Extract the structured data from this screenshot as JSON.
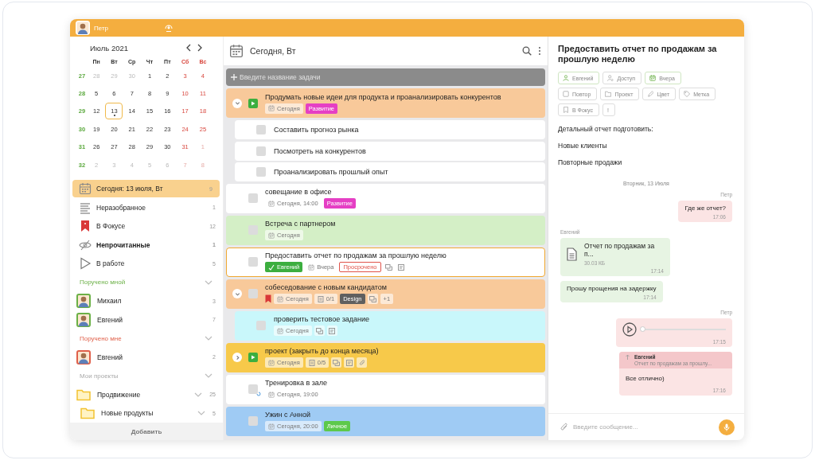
{
  "header": {
    "user": "Петр"
  },
  "calendar": {
    "month": "Июль 2021",
    "weekdays": [
      {
        "label": "Пн",
        "weekend": false
      },
      {
        "label": "Вт",
        "weekend": false
      },
      {
        "label": "Ср",
        "weekend": false
      },
      {
        "label": "Чт",
        "weekend": false
      },
      {
        "label": "Пт",
        "weekend": false
      },
      {
        "label": "Сб",
        "weekend": true
      },
      {
        "label": "Вс",
        "weekend": true
      }
    ],
    "weeks": [
      {
        "number": "27",
        "days": [
          {
            "label": "28",
            "muted": true,
            "selected": false
          },
          {
            "label": "29",
            "muted": true,
            "selected": false
          },
          {
            "label": "30",
            "muted": true,
            "selected": false
          },
          {
            "label": "1",
            "muted": false,
            "selected": false
          },
          {
            "label": "2",
            "muted": false,
            "selected": false
          },
          {
            "label": "3",
            "muted": false,
            "selected": false
          },
          {
            "label": "4",
            "muted": false,
            "selected": false
          }
        ]
      },
      {
        "number": "28",
        "days": [
          {
            "label": "5",
            "muted": false,
            "selected": false
          },
          {
            "label": "6",
            "muted": false,
            "selected": false
          },
          {
            "label": "7",
            "muted": false,
            "selected": false
          },
          {
            "label": "8",
            "muted": false,
            "selected": false
          },
          {
            "label": "9",
            "muted": false,
            "selected": false
          },
          {
            "label": "10",
            "muted": false,
            "selected": false
          },
          {
            "label": "11",
            "muted": false,
            "selected": false
          }
        ]
      },
      {
        "number": "29",
        "days": [
          {
            "label": "12",
            "muted": false,
            "selected": false
          },
          {
            "label": "13",
            "muted": false,
            "selected": true
          },
          {
            "label": "14",
            "muted": false,
            "selected": false
          },
          {
            "label": "15",
            "muted": false,
            "selected": false
          },
          {
            "label": "16",
            "muted": false,
            "selected": false
          },
          {
            "label": "17",
            "muted": false,
            "selected": false
          },
          {
            "label": "18",
            "muted": false,
            "selected": false
          }
        ]
      },
      {
        "number": "30",
        "days": [
          {
            "label": "19",
            "muted": false,
            "selected": false
          },
          {
            "label": "20",
            "muted": false,
            "selected": false
          },
          {
            "label": "21",
            "muted": false,
            "selected": false
          },
          {
            "label": "22",
            "muted": false,
            "selected": false
          },
          {
            "label": "23",
            "muted": false,
            "selected": false
          },
          {
            "label": "24",
            "muted": false,
            "selected": false
          },
          {
            "label": "25",
            "muted": false,
            "selected": false
          }
        ]
      },
      {
        "number": "31",
        "days": [
          {
            "label": "26",
            "muted": false,
            "selected": false
          },
          {
            "label": "27",
            "muted": false,
            "selected": false
          },
          {
            "label": "28",
            "muted": false,
            "selected": false
          },
          {
            "label": "29",
            "muted": false,
            "selected": false
          },
          {
            "label": "30",
            "muted": false,
            "selected": false
          },
          {
            "label": "31",
            "muted": false,
            "selected": false
          },
          {
            "label": "1",
            "muted": true,
            "selected": false
          }
        ]
      },
      {
        "number": "32",
        "days": [
          {
            "label": "2",
            "muted": true,
            "selected": false
          },
          {
            "label": "3",
            "muted": true,
            "selected": false
          },
          {
            "label": "4",
            "muted": true,
            "selected": false
          },
          {
            "label": "5",
            "muted": true,
            "selected": false
          },
          {
            "label": "6",
            "muted": true,
            "selected": false
          },
          {
            "label": "7",
            "muted": true,
            "selected": false
          },
          {
            "label": "8",
            "muted": true,
            "selected": false
          }
        ]
      }
    ]
  },
  "sidebar": {
    "items": [
      {
        "label": "Сегодня: 13 июля, Вт",
        "count": "9",
        "selected": true,
        "unread": false
      },
      {
        "label": "Неразобранное",
        "count": "1",
        "selected": false,
        "unread": false
      },
      {
        "label": "В Фокусе",
        "count": "12",
        "selected": false,
        "unread": false
      },
      {
        "label": "Непрочитанные",
        "count": "1",
        "selected": false,
        "unread": true
      },
      {
        "label": "В работе",
        "count": "5",
        "selected": false,
        "unread": false
      }
    ],
    "groups": [
      {
        "title": "Поручено мной",
        "color": "#6bb046",
        "people": [
          {
            "name": "Михаил",
            "count": "3"
          },
          {
            "name": "Евгений",
            "count": "7"
          }
        ]
      },
      {
        "title": "Поручено мне",
        "color": "#e0604a",
        "people": [
          {
            "name": "Евгений",
            "count": "2"
          }
        ]
      }
    ],
    "projects": {
      "title": "Мои проекты",
      "items": [
        {
          "name": "Продвижение",
          "count": "25",
          "children": [
            {
              "name": "Новые продукты",
              "count": "5"
            }
          ]
        }
      ]
    },
    "add_button": "Добавить"
  },
  "tasks_pane": {
    "title": "Сегодня, Вт",
    "new_task_placeholder": "Введите название задачи",
    "tasks": [
      {
        "title": "Продумать новые идеи для продукта и проанализировать конкурентов",
        "color": "#f8c99a",
        "kind": "play",
        "expanded": true,
        "selected": false,
        "chips": [
          {
            "kind": "date",
            "label": "Сегодня"
          },
          {
            "kind": "tag",
            "label": "Развитие",
            "color": "#e53fc4"
          }
        ],
        "children": [
          {
            "title": "Составить прогноз рынка",
            "color": "#ffffff",
            "kind": "checkbox",
            "selected": false
          },
          {
            "title": "Посмотреть на конкурентов",
            "color": "#ffffff",
            "kind": "checkbox",
            "selected": false
          },
          {
            "title": "Проанализировать прошлый опыт",
            "color": "#ffffff",
            "kind": "checkbox",
            "selected": false
          }
        ]
      },
      {
        "title": "совещание в офисе",
        "color": "#ffffff",
        "kind": "checkbox",
        "selected": false,
        "chips": [
          {
            "kind": "date",
            "label": "Сегодня, 14:00"
          },
          {
            "kind": "tag",
            "label": "Развитие",
            "color": "#e53fc4"
          }
        ]
      },
      {
        "title": "Встреча с партнером",
        "color": "#d4efc6",
        "kind": "checkbox",
        "selected": false,
        "chips": [
          {
            "kind": "date",
            "label": "Сегодня"
          }
        ]
      },
      {
        "title": "Предоставить отчет по продажам за прошлую неделю",
        "color": "#ffffff",
        "kind": "checkbox",
        "selected": true,
        "chips": [
          {
            "kind": "assignee",
            "label": "Евгений"
          },
          {
            "kind": "date",
            "label": "Вчера"
          },
          {
            "kind": "overdue",
            "label": "Просрочено"
          },
          {
            "kind": "comments"
          },
          {
            "kind": "notes"
          }
        ]
      },
      {
        "title": "собеседование с новым кандидатом",
        "color": "#f8c99a",
        "kind": "checkbox",
        "expanded": true,
        "selected": false,
        "chips": [
          {
            "kind": "focus"
          },
          {
            "kind": "date",
            "label": "Сегодня"
          },
          {
            "kind": "checklist",
            "label": "0/1"
          },
          {
            "kind": "tag",
            "label": "Design",
            "color": "#5f5f5f"
          },
          {
            "kind": "comments"
          },
          {
            "kind": "more",
            "label": "+1"
          }
        ],
        "children": [
          {
            "title": "проверить тестовое задание",
            "color": "#c9f7fb",
            "kind": "checkbox",
            "selected": false,
            "chips": [
              {
                "kind": "date",
                "label": "Сегодня"
              },
              {
                "kind": "comments"
              },
              {
                "kind": "notes"
              }
            ]
          }
        ]
      },
      {
        "title": "проект (закрыть до конца месяца)",
        "color": "#f7c94a",
        "kind": "play",
        "expanded": false,
        "selected": false,
        "chips": [
          {
            "kind": "date",
            "label": "Сегодня"
          },
          {
            "kind": "checklist",
            "label": "0/5"
          },
          {
            "kind": "comments"
          },
          {
            "kind": "notes"
          },
          {
            "kind": "attachment"
          }
        ]
      },
      {
        "title": "Тренировка в зале",
        "color": "#ffffff",
        "kind": "repeat",
        "selected": false,
        "chips": [
          {
            "kind": "date",
            "label": "Сегодня, 19:00"
          }
        ]
      },
      {
        "title": "Ужин с Анной",
        "color": "#9fcbf4",
        "kind": "checkbox",
        "selected": false,
        "chips": [
          {
            "kind": "date",
            "label": "Сегодня, 20:00"
          },
          {
            "kind": "tag",
            "label": "Личное",
            "color": "#5dc94b"
          }
        ]
      }
    ]
  },
  "detail": {
    "title": "Предоставить отчет по продажам за прошлую неделю",
    "actions": [
      [
        {
          "label": "Евгений",
          "set": true
        },
        {
          "label": "Доступ",
          "set": false
        },
        {
          "label": "Вчера",
          "set": true
        }
      ],
      [
        {
          "label": "Повтор",
          "set": false
        },
        {
          "label": "Проект",
          "set": false
        },
        {
          "label": "Цвет",
          "set": false
        },
        {
          "label": "Метка",
          "set": false
        }
      ],
      [
        {
          "label": "В Фокус",
          "set": false
        },
        {
          "label": "!",
          "set": false
        }
      ]
    ],
    "notes": [
      "Детальный отчет подготовить:",
      "Новые клиенты",
      "Повторные продажи"
    ]
  },
  "chat": {
    "date": "Вторник, 13 Июля",
    "messages": [
      {
        "kind": "text",
        "own": true,
        "author": "Петр",
        "text": "Где же отчет?",
        "time": "17:06"
      },
      {
        "kind": "file",
        "own": false,
        "author": "Евгений",
        "name": "Отчет по продажам за п...",
        "size": "30.03 КБ",
        "time": "17:14"
      },
      {
        "kind": "text",
        "own": false,
        "text": "Прошу прощения на задержку",
        "time": "17:14"
      },
      {
        "kind": "audio",
        "own": true,
        "author": "Петр",
        "level": 0.03,
        "time": "17:15"
      },
      {
        "kind": "reply",
        "own": true,
        "quote_author": "Евгений",
        "quote_text": "Отчет по продажам за прошлу...",
        "text": "Все отлично)",
        "time": "17:16"
      }
    ],
    "placeholder": "Введите сообщение..."
  }
}
